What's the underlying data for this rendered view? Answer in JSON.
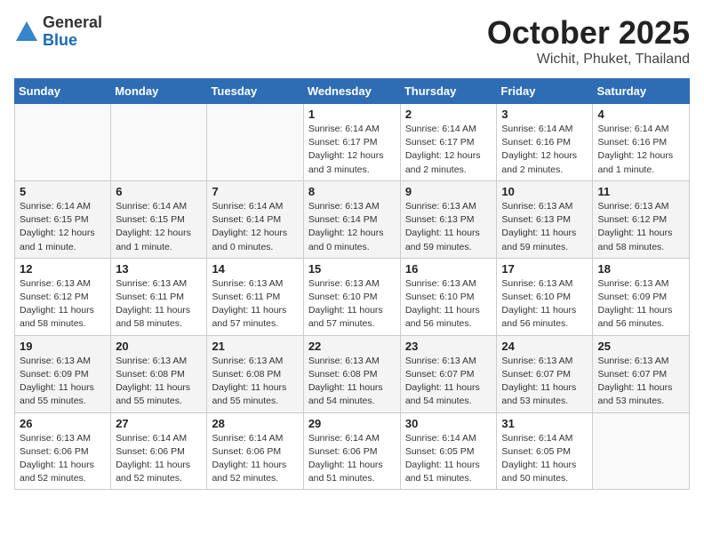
{
  "header": {
    "logo_general": "General",
    "logo_blue": "Blue",
    "month_title": "October 2025",
    "location": "Wichit, Phuket, Thailand"
  },
  "days_of_week": [
    "Sunday",
    "Monday",
    "Tuesday",
    "Wednesday",
    "Thursday",
    "Friday",
    "Saturday"
  ],
  "weeks": [
    [
      {
        "day": "",
        "info": ""
      },
      {
        "day": "",
        "info": ""
      },
      {
        "day": "",
        "info": ""
      },
      {
        "day": "1",
        "info": "Sunrise: 6:14 AM\nSunset: 6:17 PM\nDaylight: 12 hours\nand 3 minutes."
      },
      {
        "day": "2",
        "info": "Sunrise: 6:14 AM\nSunset: 6:17 PM\nDaylight: 12 hours\nand 2 minutes."
      },
      {
        "day": "3",
        "info": "Sunrise: 6:14 AM\nSunset: 6:16 PM\nDaylight: 12 hours\nand 2 minutes."
      },
      {
        "day": "4",
        "info": "Sunrise: 6:14 AM\nSunset: 6:16 PM\nDaylight: 12 hours\nand 1 minute."
      }
    ],
    [
      {
        "day": "5",
        "info": "Sunrise: 6:14 AM\nSunset: 6:15 PM\nDaylight: 12 hours\nand 1 minute."
      },
      {
        "day": "6",
        "info": "Sunrise: 6:14 AM\nSunset: 6:15 PM\nDaylight: 12 hours\nand 1 minute."
      },
      {
        "day": "7",
        "info": "Sunrise: 6:14 AM\nSunset: 6:14 PM\nDaylight: 12 hours\nand 0 minutes."
      },
      {
        "day": "8",
        "info": "Sunrise: 6:13 AM\nSunset: 6:14 PM\nDaylight: 12 hours\nand 0 minutes."
      },
      {
        "day": "9",
        "info": "Sunrise: 6:13 AM\nSunset: 6:13 PM\nDaylight: 11 hours\nand 59 minutes."
      },
      {
        "day": "10",
        "info": "Sunrise: 6:13 AM\nSunset: 6:13 PM\nDaylight: 11 hours\nand 59 minutes."
      },
      {
        "day": "11",
        "info": "Sunrise: 6:13 AM\nSunset: 6:12 PM\nDaylight: 11 hours\nand 58 minutes."
      }
    ],
    [
      {
        "day": "12",
        "info": "Sunrise: 6:13 AM\nSunset: 6:12 PM\nDaylight: 11 hours\nand 58 minutes."
      },
      {
        "day": "13",
        "info": "Sunrise: 6:13 AM\nSunset: 6:11 PM\nDaylight: 11 hours\nand 58 minutes."
      },
      {
        "day": "14",
        "info": "Sunrise: 6:13 AM\nSunset: 6:11 PM\nDaylight: 11 hours\nand 57 minutes."
      },
      {
        "day": "15",
        "info": "Sunrise: 6:13 AM\nSunset: 6:10 PM\nDaylight: 11 hours\nand 57 minutes."
      },
      {
        "day": "16",
        "info": "Sunrise: 6:13 AM\nSunset: 6:10 PM\nDaylight: 11 hours\nand 56 minutes."
      },
      {
        "day": "17",
        "info": "Sunrise: 6:13 AM\nSunset: 6:10 PM\nDaylight: 11 hours\nand 56 minutes."
      },
      {
        "day": "18",
        "info": "Sunrise: 6:13 AM\nSunset: 6:09 PM\nDaylight: 11 hours\nand 56 minutes."
      }
    ],
    [
      {
        "day": "19",
        "info": "Sunrise: 6:13 AM\nSunset: 6:09 PM\nDaylight: 11 hours\nand 55 minutes."
      },
      {
        "day": "20",
        "info": "Sunrise: 6:13 AM\nSunset: 6:08 PM\nDaylight: 11 hours\nand 55 minutes."
      },
      {
        "day": "21",
        "info": "Sunrise: 6:13 AM\nSunset: 6:08 PM\nDaylight: 11 hours\nand 55 minutes."
      },
      {
        "day": "22",
        "info": "Sunrise: 6:13 AM\nSunset: 6:08 PM\nDaylight: 11 hours\nand 54 minutes."
      },
      {
        "day": "23",
        "info": "Sunrise: 6:13 AM\nSunset: 6:07 PM\nDaylight: 11 hours\nand 54 minutes."
      },
      {
        "day": "24",
        "info": "Sunrise: 6:13 AM\nSunset: 6:07 PM\nDaylight: 11 hours\nand 53 minutes."
      },
      {
        "day": "25",
        "info": "Sunrise: 6:13 AM\nSunset: 6:07 PM\nDaylight: 11 hours\nand 53 minutes."
      }
    ],
    [
      {
        "day": "26",
        "info": "Sunrise: 6:13 AM\nSunset: 6:06 PM\nDaylight: 11 hours\nand 52 minutes."
      },
      {
        "day": "27",
        "info": "Sunrise: 6:14 AM\nSunset: 6:06 PM\nDaylight: 11 hours\nand 52 minutes."
      },
      {
        "day": "28",
        "info": "Sunrise: 6:14 AM\nSunset: 6:06 PM\nDaylight: 11 hours\nand 52 minutes."
      },
      {
        "day": "29",
        "info": "Sunrise: 6:14 AM\nSunset: 6:06 PM\nDaylight: 11 hours\nand 51 minutes."
      },
      {
        "day": "30",
        "info": "Sunrise: 6:14 AM\nSunset: 6:05 PM\nDaylight: 11 hours\nand 51 minutes."
      },
      {
        "day": "31",
        "info": "Sunrise: 6:14 AM\nSunset: 6:05 PM\nDaylight: 11 hours\nand 50 minutes."
      },
      {
        "day": "",
        "info": ""
      }
    ]
  ]
}
